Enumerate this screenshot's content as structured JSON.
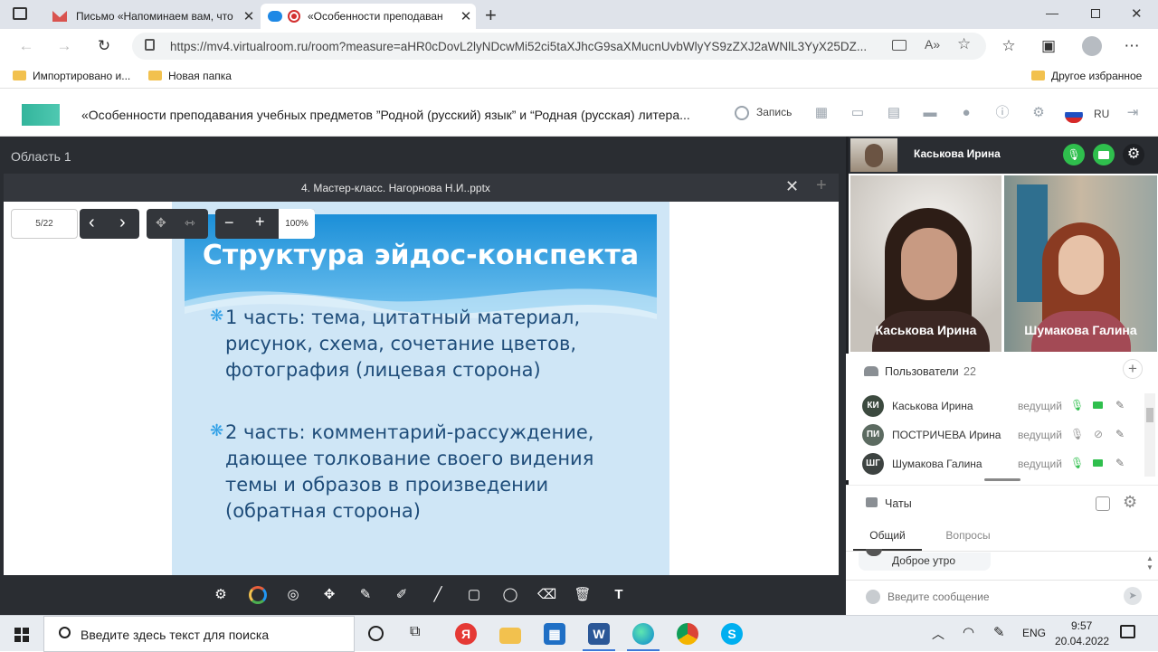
{
  "browser": {
    "tabs": [
      {
        "title": "Письмо «Напоминаем вам, что",
        "active": false
      },
      {
        "title": "«Особенности преподаван",
        "active": true
      }
    ],
    "url": "https://mv4.virtualroom.ru/room?measure=aHR0cDovL2lyNDcwMi52ci5taXJhcG9saXMucnUvbWlyYS9zZXJ2aWNlL3YyX25DZ...",
    "bookmarks": [
      {
        "label": "Импортировано и..."
      },
      {
        "label": "Новая папка"
      }
    ],
    "other_bookmarks": "Другое избранное"
  },
  "app": {
    "title": "«Особенности преподавания учебных предметов ”Родной (русский) язык” и “Родная (русская) литера...",
    "record_label": "Запись",
    "language": "RU"
  },
  "workspace": {
    "area_title": "Область 1",
    "document_name": "4. Мастер-класс. Нагорнова Н.И..pptx",
    "page_indicator": "5/22",
    "zoom": "100%",
    "zoom_percent": 100,
    "slide": {
      "heading": "Структура эйдос-конспекта",
      "bullets": [
        "1 часть: тема, цитатный материал, рисунок, схема, сочетание цветов, фотография (лицевая сторона)",
        "2 часть: комментарий-рассуждение, дающее толкование своего видения темы и образов в произведении (обратная сторона)"
      ]
    }
  },
  "video": {
    "speaker_name": "Каськова Ирина",
    "participants": [
      {
        "name": "Каськова Ирина"
      },
      {
        "name": "Шумакова Галина"
      }
    ]
  },
  "users_panel": {
    "title": "Пользователи",
    "count": "22",
    "users": [
      {
        "initials": "КИ",
        "name": "Каськова Ирина",
        "role": "ведущий",
        "mic_on": true,
        "cam_on": true,
        "avatar_color": "#3c4a3f"
      },
      {
        "initials": "ПИ",
        "name": "ПОСТРИЧЕВА Ирина",
        "role": "ведущий",
        "mic_on": false,
        "cam_on": false,
        "avatar_color": "#5c6b61"
      },
      {
        "initials": "ШГ",
        "name": "Шумакова Галина",
        "role": "ведущий",
        "mic_on": true,
        "cam_on": true,
        "avatar_color": "#3d4341"
      }
    ]
  },
  "chat_panel": {
    "title": "Чаты",
    "tabs": [
      {
        "label": "Общий",
        "active": true
      },
      {
        "label": "Вопросы",
        "active": false
      }
    ],
    "last_message": "Доброе утро",
    "input_placeholder": "Введите сообщение"
  },
  "taskbar": {
    "search_placeholder": "Введите здесь текст для поиска",
    "language": "ENG",
    "time": "9:57",
    "date": "20.04.2022"
  },
  "colors": {
    "accent_green": "#2fbf4d",
    "dark_panel": "#2a2d32",
    "slide_text": "#1f4d7a",
    "slide_header_text": "#ffffff"
  }
}
